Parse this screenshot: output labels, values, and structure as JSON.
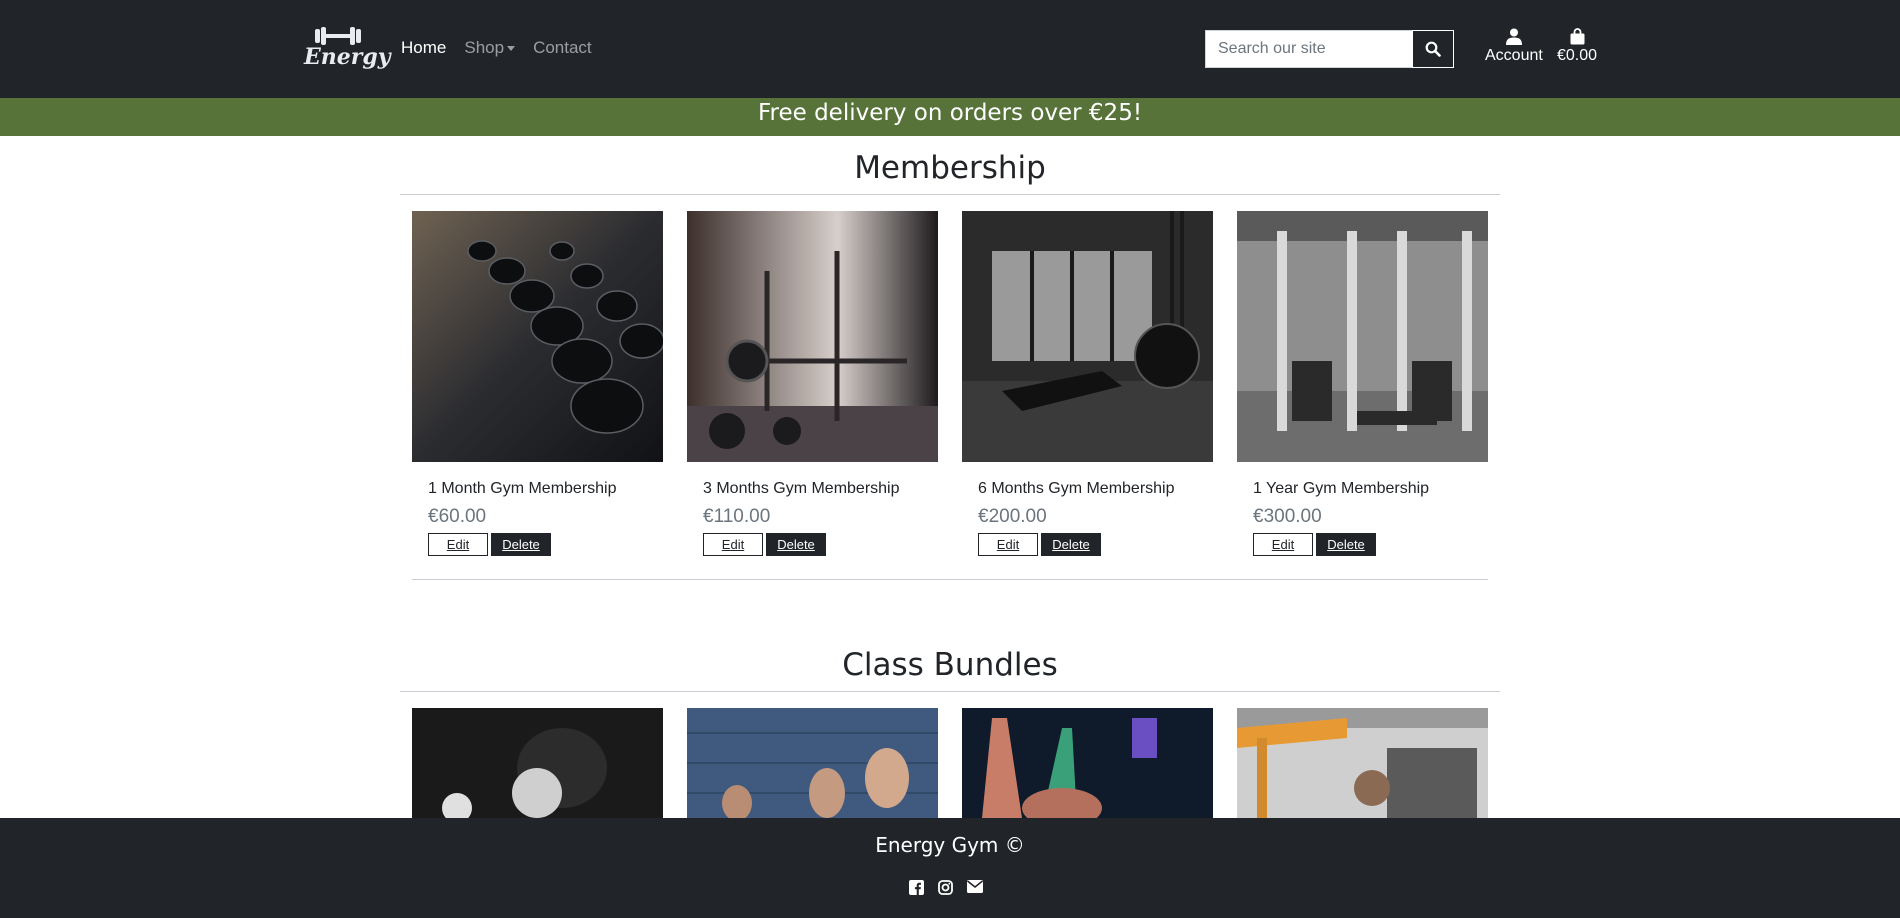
{
  "nav": {
    "brand": "Energy",
    "links": [
      {
        "label": "Home"
      },
      {
        "label": "Shop"
      },
      {
        "label": "Contact"
      }
    ],
    "search_placeholder": "Search our site",
    "account_label": "Account",
    "cart_total": "€0.00"
  },
  "banner": {
    "text": "Free delivery on orders over €25!"
  },
  "sections": [
    {
      "title": "Membership",
      "products": [
        {
          "name": "1 Month Gym Membership",
          "price": "€60.00",
          "edit": "Edit",
          "delete": "Delete"
        },
        {
          "name": "3 Months Gym Membership",
          "price": "€110.00",
          "edit": "Edit",
          "delete": "Delete"
        },
        {
          "name": "6 Months Gym Membership",
          "price": "€200.00",
          "edit": "Edit",
          "delete": "Delete"
        },
        {
          "name": "1 Year Gym Membership",
          "price": "€300.00",
          "edit": "Edit",
          "delete": "Delete"
        }
      ]
    },
    {
      "title": "Class Bundles"
    }
  ],
  "footer": {
    "title": "Energy Gym ©",
    "icons": [
      "facebook-icon",
      "instagram-icon",
      "envelope-icon"
    ]
  },
  "colors": {
    "navbar": "#212529",
    "banner": "#577339",
    "muted_text": "#6c757d"
  }
}
